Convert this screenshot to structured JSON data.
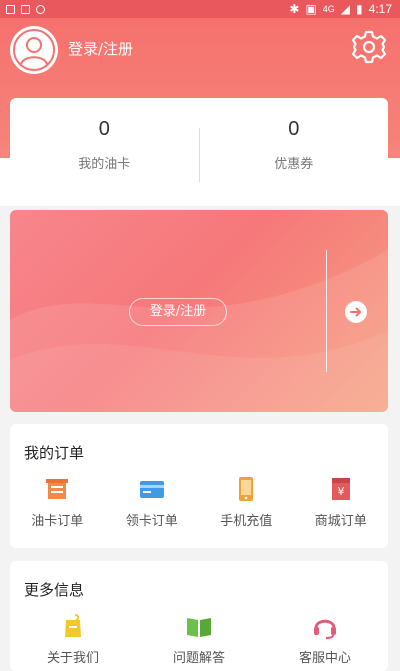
{
  "status_bar": {
    "network": "4G",
    "time": "4:17"
  },
  "header": {
    "login_label": "登录/注册"
  },
  "stats": [
    {
      "value": "0",
      "label": "我的油卡"
    },
    {
      "value": "0",
      "label": "优惠券"
    }
  ],
  "promo": {
    "login_button": "登录/注册"
  },
  "orders": {
    "title": "我的订单",
    "items": [
      {
        "label": "油卡订单",
        "icon": "oil-card-order-icon"
      },
      {
        "label": "领卡订单",
        "icon": "card-order-icon"
      },
      {
        "label": "手机充值",
        "icon": "phone-recharge-icon"
      },
      {
        "label": "商城订单",
        "icon": "mall-order-icon"
      }
    ]
  },
  "more": {
    "title": "更多信息",
    "items": [
      {
        "label": "关于我们",
        "icon": "about-us-icon"
      },
      {
        "label": "问题解答",
        "icon": "faq-book-icon"
      },
      {
        "label": "客服中心",
        "icon": "customer-service-icon"
      }
    ]
  },
  "colors": {
    "brand": "#f6716d",
    "accent_orange": "#f08a4b",
    "accent_blue": "#3f9be6",
    "accent_green": "#6cc04a",
    "accent_pink": "#e45a7a"
  }
}
